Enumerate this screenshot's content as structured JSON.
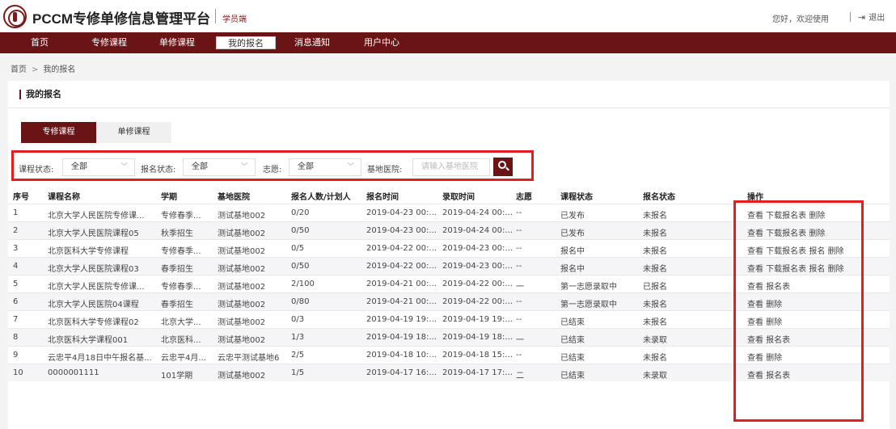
{
  "header": {
    "brand": "PCCM专修单修信息管理平台",
    "sub": "学员端",
    "welcome": "您好，欢迎使用",
    "logout": "退出"
  },
  "nav": [
    "首页",
    "专修课程",
    "单修课程",
    "我的报名",
    "消息通知",
    "用户中心"
  ],
  "nav_active": "我的报名",
  "breadcrumb": {
    "home": "首页",
    "separator": ">",
    "current": "我的报名"
  },
  "panel_title": "我的报名",
  "tabs": [
    "专修课程",
    "单修课程"
  ],
  "filters": {
    "course_status_label": "课程状态:",
    "course_status_value": "全部",
    "signup_status_label": "报名状态:",
    "signup_status_value": "全部",
    "wish_label": "志愿:",
    "wish_value": "全部",
    "hospital_label": "基地医院:",
    "hospital_placeholder": "请输入基地医院"
  },
  "columns": [
    "序号",
    "课程名称",
    "学期",
    "基地医院",
    "报名人数/计划人",
    "报名时间",
    "录取时间",
    "志愿",
    "课程状态",
    "报名状态",
    "操作"
  ],
  "rows": [
    {
      "no": "1",
      "name": "北京大学人民医院专修课...",
      "term": "专修春季...",
      "hospital": "测试基地002",
      "count": "0/20",
      "signup": "2019-04-23 00:...",
      "admit": "2019-04-24 00:...",
      "wish": "--",
      "cstatus": "已发布",
      "sstatus": "未报名",
      "ops": "查看 下载报名表 删除"
    },
    {
      "no": "2",
      "name": "北京大学人民医院课程05",
      "term": "秋季招生",
      "hospital": "测试基地002",
      "count": "0/50",
      "signup": "2019-04-23 00:...",
      "admit": "2019-04-24 00:...",
      "wish": "--",
      "cstatus": "已发布",
      "sstatus": "未报名",
      "ops": "查看 下载报名表 删除"
    },
    {
      "no": "3",
      "name": "北京医科大学专修课程",
      "term": "专修春季...",
      "hospital": "测试基地002",
      "count": "0/5",
      "signup": "2019-04-22 00:...",
      "admit": "2019-04-23 00:...",
      "wish": "--",
      "cstatus": "报名中",
      "sstatus": "未报名",
      "ops": "查看 下载报名表 报名 删除"
    },
    {
      "no": "4",
      "name": "北京大学人民医院课程03",
      "term": "春季招生",
      "hospital": "测试基地002",
      "count": "0/50",
      "signup": "2019-04-22 00:...",
      "admit": "2019-04-23 00:...",
      "wish": "--",
      "cstatus": "报名中",
      "sstatus": "未报名",
      "ops": "查看 下载报名表 报名 删除"
    },
    {
      "no": "5",
      "name": "北京大学人民医院专修课...",
      "term": "专修春季...",
      "hospital": "测试基地002",
      "count": "2/100",
      "signup": "2019-04-21 00:...",
      "admit": "2019-04-22 00:...",
      "wish": "一",
      "cstatus": "第一志愿录取中",
      "sstatus": "已报名",
      "ops": "查看 报名表"
    },
    {
      "no": "6",
      "name": "北京大学人民医院04课程",
      "term": "春季招生",
      "hospital": "测试基地002",
      "count": "0/80",
      "signup": "2019-04-21 00:...",
      "admit": "2019-04-22 00:...",
      "wish": "--",
      "cstatus": "第一志愿录取中",
      "sstatus": "未报名",
      "ops": "查看 删除"
    },
    {
      "no": "7",
      "name": "北京医科大学专修课程02",
      "term": "北京大学...",
      "hospital": "测试基地002",
      "count": "0/3",
      "signup": "2019-04-19 19:...",
      "admit": "2019-04-19 19:...",
      "wish": "--",
      "cstatus": "已结束",
      "sstatus": "未报名",
      "ops": "查看 删除"
    },
    {
      "no": "8",
      "name": "北京医科大学课程001",
      "term": "北京医科...",
      "hospital": "测试基地002",
      "count": "1/3",
      "signup": "2019-04-19 18:...",
      "admit": "2019-04-19 18:...",
      "wish": "一",
      "cstatus": "已结束",
      "sstatus": "未录取",
      "ops": "查看 报名表"
    },
    {
      "no": "9",
      "name": "云忠平4月18日中午报名基...",
      "term": "云忠平4月...",
      "hospital": "云忠平测试基地6",
      "count": "2/5",
      "signup": "2019-04-18 10:...",
      "admit": "2019-04-18 15:...",
      "wish": "--",
      "cstatus": "已结束",
      "sstatus": "未报名",
      "ops": "查看 删除"
    },
    {
      "no": "10",
      "name": "0000001111",
      "term": "101学期",
      "hospital": "测试基地002",
      "count": "1/5",
      "signup": "2019-04-17 16:...",
      "admit": "2019-04-17 17:...",
      "wish": "二",
      "cstatus": "已结束",
      "sstatus": "未录取",
      "ops": "查看 报名表"
    }
  ],
  "colors": {
    "brand": "#6b1416",
    "highlight": "#e41e1e"
  }
}
